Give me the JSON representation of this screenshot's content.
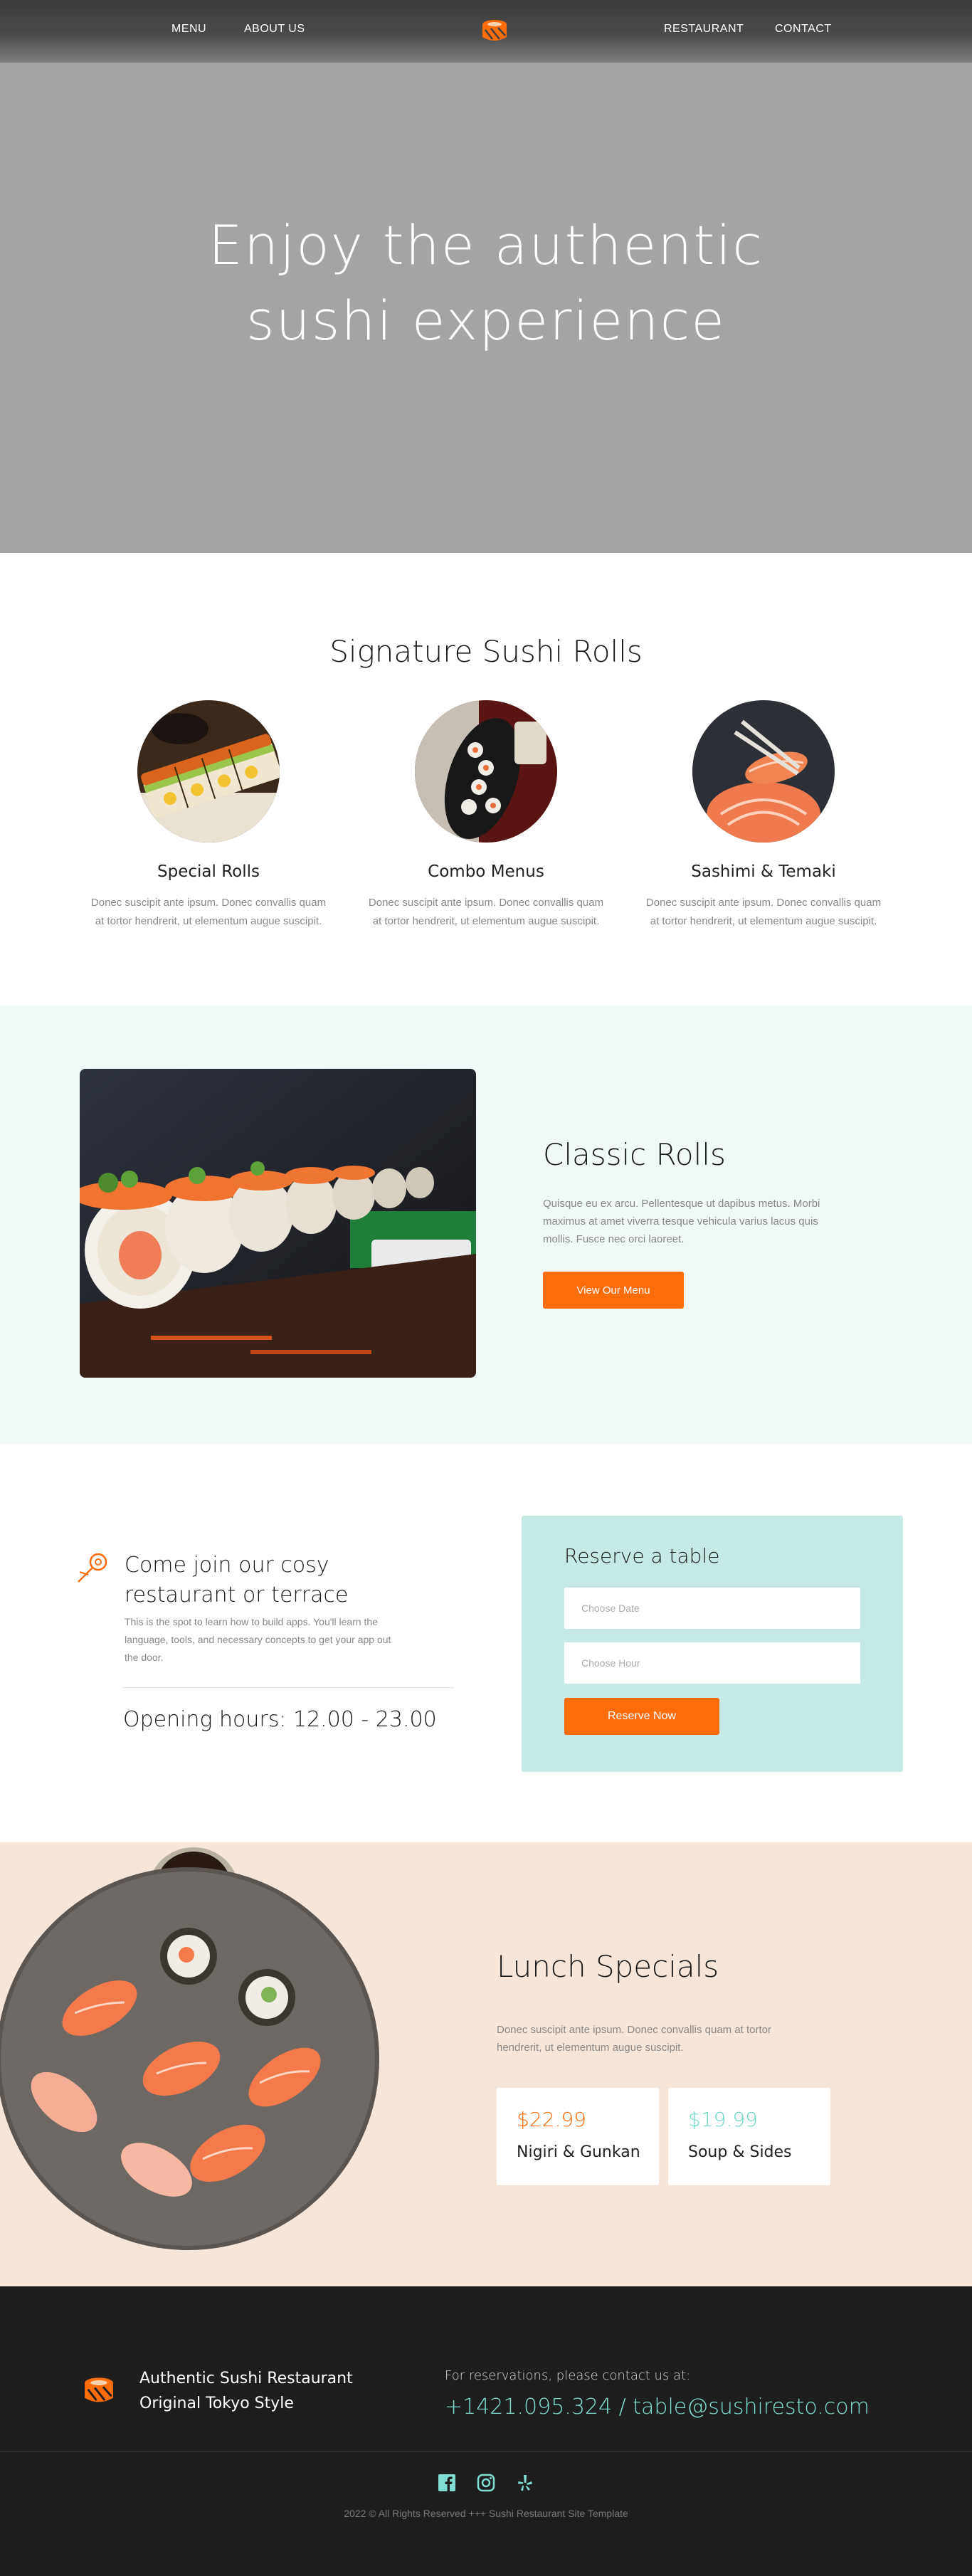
{
  "nav": {
    "left": [
      {
        "label": "MENU"
      },
      {
        "label": "ABOUT US"
      }
    ],
    "right": [
      {
        "label": "RESTAURANT"
      },
      {
        "label": "CONTACT"
      }
    ],
    "logo_icon": "sushi-roll-logo-icon"
  },
  "hero": {
    "line1": "Enjoy the authentic",
    "line2": "sushi experience"
  },
  "signature": {
    "title": "Signature Sushi Rolls",
    "items": [
      {
        "name": "Special Rolls",
        "desc": "Donec suscipit ante ipsum. Donec convallis quam at tortor hendrerit, ut elementum augue suscipit."
      },
      {
        "name": "Combo Menus",
        "desc": "Donec suscipit ante ipsum. Donec convallis quam at tortor hendrerit, ut elementum augue suscipit."
      },
      {
        "name": "Sashimi & Temaki",
        "desc": "Donec suscipit ante ipsum. Donec convallis quam at tortor hendrerit, ut elementum augue suscipit."
      }
    ]
  },
  "classic": {
    "title": "Classic Rolls",
    "text": "Quisque eu ex arcu. Pellentesque ut dapibus metus. Morbi maximus at amet viverra tesque vehicula varius lacus quis mollis. Fusce nec orci laoreet.",
    "button": "View Our Menu"
  },
  "reserve": {
    "join_title": "Come join our cosy restaurant or terrace",
    "join_text": "This is the spot to learn how to build apps. You'll learn the language, tools, and necessary concepts to get your app out the door.",
    "hours": "Opening hours: 12.00 - 23.00",
    "form_title": "Reserve a table",
    "date_placeholder": "Choose Date",
    "hour_placeholder": "Choose Hour",
    "button": "Reserve Now"
  },
  "lunch": {
    "title": "Lunch Specials",
    "text": "Donec suscipit ante ipsum. Donec convallis quam at tortor hendrerit, ut elementum augue suscipit.",
    "cards": [
      {
        "price": "$22.99",
        "name": "Nigiri & Gunkan",
        "color": "#ff6c0a"
      },
      {
        "price": "$19.99",
        "name": "Soup & Sides",
        "color": "#6fd6ca"
      }
    ]
  },
  "footer": {
    "brand_line1": "Authentic Sushi Restaurant",
    "brand_line2": "Original Tokyo Style",
    "res_label": "For reservations, please contact us at:",
    "res_contact": "+1421.095.324 / table@sushiresto.com",
    "social": [
      "facebook-icon",
      "instagram-icon",
      "yelp-icon"
    ],
    "copyright": "2022 © All Rights Reserved +++ Sushi Restaurant Site Template"
  },
  "colors": {
    "accent": "#ff6c0a",
    "teal": "#80ddd1",
    "panel": "#c6e9e5",
    "lunch_bg": "#f6e6da",
    "classic_bg": "#f1f8f8",
    "footer_bg": "#1e1e1e"
  }
}
